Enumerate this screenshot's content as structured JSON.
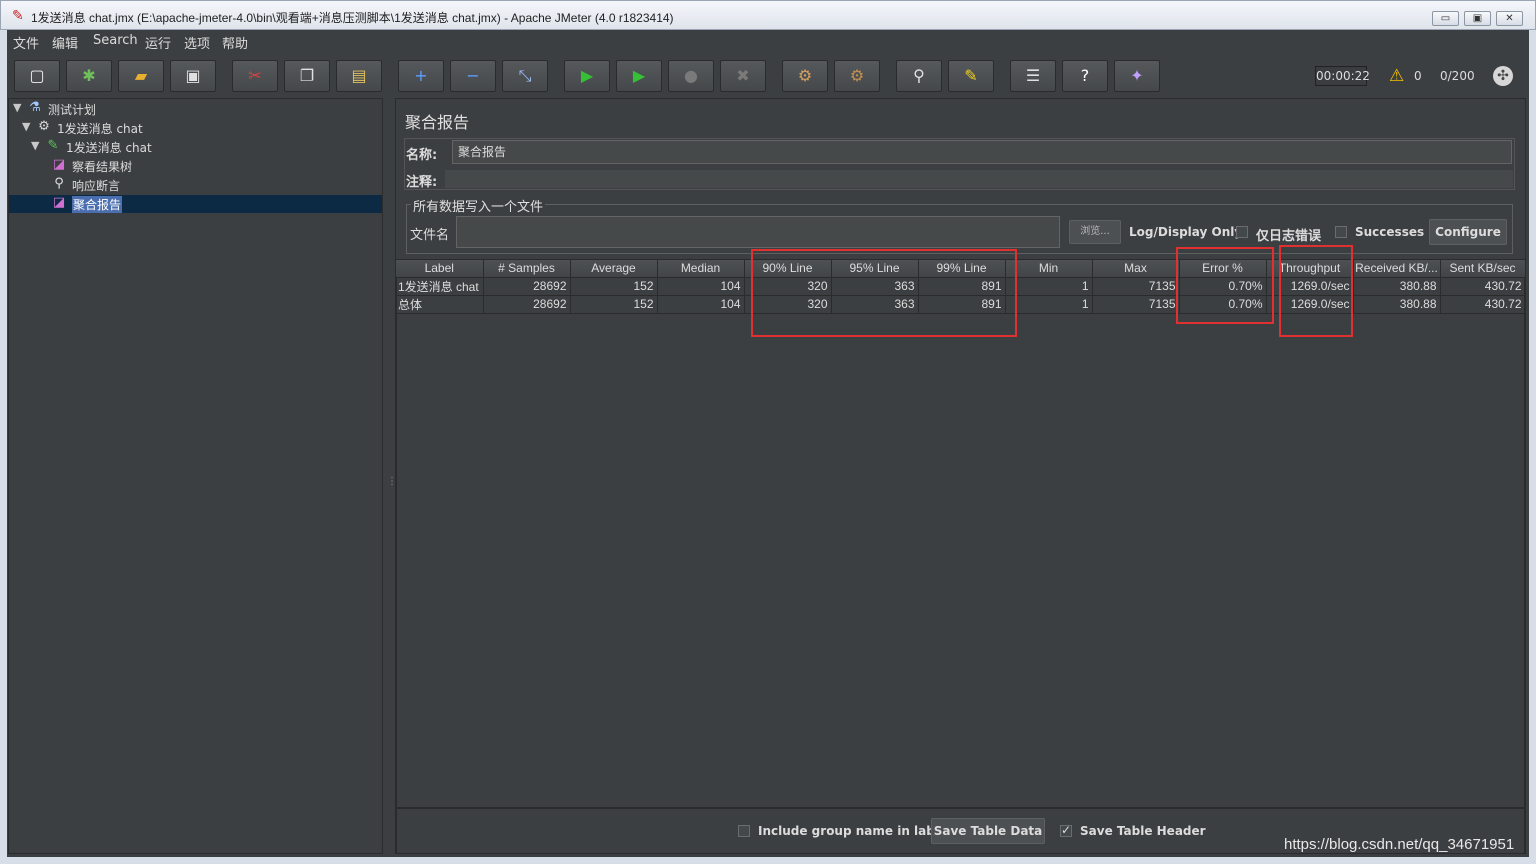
{
  "window": {
    "title": "1发送消息 chat.jmx (E:\\apache-jmeter-4.0\\bin\\观看端+消息压测脚本\\1发送消息 chat.jmx) - Apache JMeter (4.0 r1823414)",
    "min_glyph": "▭",
    "max_glyph": "▣",
    "close_glyph": "✕"
  },
  "menu": [
    "文件",
    "编辑",
    "Search",
    "运行",
    "选项",
    "帮助"
  ],
  "toolbar": {
    "buttons": [
      {
        "name": "new-icon",
        "glyph": "▢",
        "color": "#f0f0f0"
      },
      {
        "name": "templates-icon",
        "glyph": "✱",
        "color": "#6fbf5a"
      },
      {
        "name": "open-icon",
        "glyph": "▰",
        "color": "#e8b030"
      },
      {
        "name": "save-icon",
        "glyph": "▣",
        "color": "#e0e0e0"
      },
      {
        "name": "cut-icon",
        "glyph": "✂",
        "color": "#e04040"
      },
      {
        "name": "copy-icon",
        "glyph": "❐",
        "color": "#e0e0e0"
      },
      {
        "name": "paste-icon",
        "glyph": "▤",
        "color": "#e0c060"
      },
      {
        "name": "expand-icon",
        "glyph": "+",
        "color": "#5aa0ff"
      },
      {
        "name": "collapse-icon",
        "glyph": "−",
        "color": "#5aa0ff"
      },
      {
        "name": "toggle-icon",
        "glyph": "⤡",
        "color": "#a0c0ff"
      },
      {
        "name": "start-icon",
        "glyph": "▶",
        "color": "#35c035"
      },
      {
        "name": "start-no-pauses-icon",
        "glyph": "▶",
        "color": "#35c035"
      },
      {
        "name": "stop-icon",
        "glyph": "●",
        "color": "#7a7a7a"
      },
      {
        "name": "shutdown-icon",
        "glyph": "✖",
        "color": "#7a7a7a"
      },
      {
        "name": "clear-icon",
        "glyph": "⚙",
        "color": "#d0a060"
      },
      {
        "name": "clear-all-icon",
        "glyph": "⚙",
        "color": "#c09050"
      },
      {
        "name": "search-icon",
        "glyph": "⚲",
        "color": "#e0e0e0"
      },
      {
        "name": "reset-search-icon",
        "glyph": "✎",
        "color": "#f0d020"
      },
      {
        "name": "function-helper-icon",
        "glyph": "☰",
        "color": "#e0e0e0"
      },
      {
        "name": "help-icon",
        "glyph": "?",
        "color": "#ffffff"
      },
      {
        "name": "remote-icon",
        "glyph": "✦",
        "color": "#c0a0ff"
      }
    ],
    "timer": "00:00:22",
    "warning_glyph": "⚠",
    "warning_count": "0",
    "threads": "0/200",
    "globe_glyph": "✣"
  },
  "tree": [
    {
      "label": "测试计划",
      "icon": "⚗",
      "icon_color": "#a0c8ff",
      "level": 0,
      "arrow": "▼"
    },
    {
      "label": "1发送消息 chat",
      "icon": "⚙",
      "icon_color": "#d8d8d8",
      "level": 1,
      "arrow": "▼"
    },
    {
      "label": "1发送消息 chat",
      "icon": "✎",
      "icon_color": "#60c060",
      "level": 2,
      "arrow": "▼"
    },
    {
      "label": "察看结果树",
      "icon": "◪",
      "icon_color": "#d070d0",
      "level": 3,
      "arrow": ""
    },
    {
      "label": "响应断言",
      "icon": "⚲",
      "icon_color": "#e0e0e0",
      "level": 3,
      "arrow": ""
    },
    {
      "label": "聚合报告",
      "icon": "◪",
      "icon_color": "#d070d0",
      "level": 3,
      "arrow": "",
      "selected": true
    }
  ],
  "panel": {
    "title": "聚合报告",
    "name_label": "名称:",
    "name_value": "聚合报告",
    "comment_label": "注释:",
    "file_group_legend": "所有数据写入一个文件",
    "file_label": "文件名",
    "browse_label": "浏览...",
    "log_display_label": "Log/Display Only:",
    "errors_only_label": "仅日志错误",
    "successes_label": "Successes",
    "configure_label": "Configure"
  },
  "table": {
    "headers": [
      "Label",
      "# Samples",
      "Average",
      "Median",
      "90% Line",
      "95% Line",
      "99% Line",
      "Min",
      "Max",
      "Error %",
      "Throughput",
      "Received KB/...",
      "Sent KB/sec"
    ],
    "rows": [
      [
        "1发送消息 chat",
        "28692",
        "152",
        "104",
        "320",
        "363",
        "891",
        "1",
        "7135",
        "0.70%",
        "1269.0/sec",
        "380.88",
        "430.72"
      ],
      [
        "总体",
        "28692",
        "152",
        "104",
        "320",
        "363",
        "891",
        "1",
        "7135",
        "0.70%",
        "1269.0/sec",
        "380.88",
        "430.72"
      ]
    ]
  },
  "bottom": {
    "include_group_label": "Include group name in label?",
    "save_table_data": "Save Table Data",
    "save_table_header": "Save Table Header"
  },
  "watermark": "https://blog.csdn.net/qq_34671951",
  "colors": {
    "highlight": "#e03030",
    "selection": "#4b6eaf",
    "background": "#3c3f41"
  }
}
